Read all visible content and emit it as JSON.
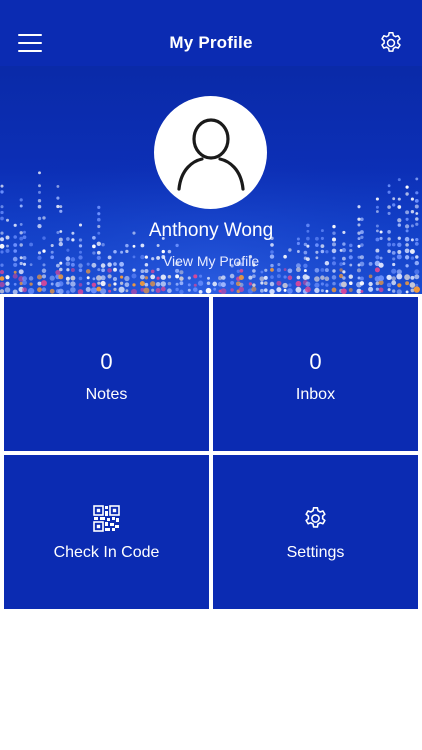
{
  "header": {
    "title": "My Profile",
    "menu_icon": "hamburger-menu-icon",
    "settings_icon": "gear-icon"
  },
  "profile": {
    "name": "Anthony Wong",
    "view_link": "View My Profile",
    "avatar_icon": "person-outline-icon"
  },
  "tiles": [
    {
      "count": "0",
      "label": "Notes"
    },
    {
      "count": "0",
      "label": "Inbox"
    },
    {
      "icon": "qr-code-icon",
      "label": "Check In Code"
    },
    {
      "icon": "gear-icon",
      "label": "Settings"
    }
  ],
  "colors": {
    "primary": "#0b2bb2",
    "text": "#ffffff",
    "background": "#ffffff"
  }
}
